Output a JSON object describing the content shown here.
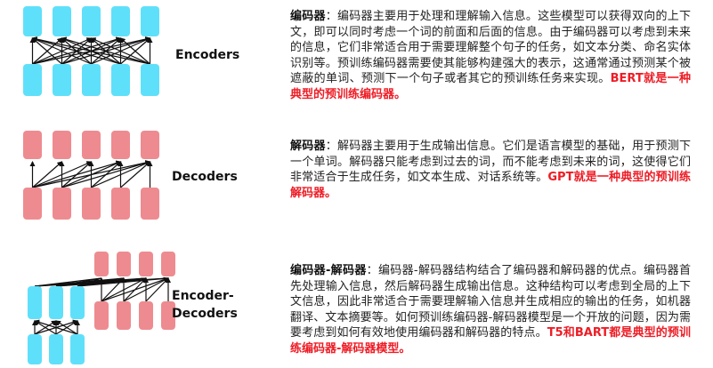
{
  "colors": {
    "encoder": "#5fe0fa",
    "decoder": "#ee8b90",
    "arrow": "#111111",
    "highlight": "#ee1c25"
  },
  "rows": [
    {
      "id": "encoders",
      "label": "Encoders",
      "term": "编码器",
      "colon": "：",
      "body": "编码器主要用于处理和理解输入信息。这些模型可以获得双向的上下文，即可以同时考虑一个词的前面和后面的信息。由于编码器可以考虑到未来的信息，它们非常适合用于需要理解整个句子的任务，如文本分类、命名实体识别等。预训练编码器需要使其能够构建强大的表示，这通常通过预测某个被遮蔽的单词、预测下一个句子或者其它的预训练任务来实现。",
      "highlight": "BERT就是一种典型的预训练编码器。"
    },
    {
      "id": "decoders",
      "label": "Decoders",
      "term": "解码器",
      "colon": "：",
      "body": "解码器主要用于生成输出信息。它们是语言模型的基础，用于预测下一个单词。解码器只能考虑到过去的词，而不能考虑到未来的词，这使得它们非常适合于生成任务，如文本生成、对话系统等。",
      "highlight": "GPT就是一种典型的预训练解码器。"
    },
    {
      "id": "encoder-decoders",
      "label_line1": "Encoder-",
      "label_line2": "Decoders",
      "term": "编码器-解码器",
      "colon": "：",
      "body": "编码器-解码器结构结合了编码器和解码器的优点。编码器首先处理输入信息，然后解码器生成输出信息。这种结构可以考虑到全局的上下文信息，因此非常适合于需要理解输入信息并生成相应的输出的任务，如机器翻译、文本摘要等。如何预训练编码器-解码器模型是一个开放的问题，因为需要考虑到如何有效地使用编码器和解码器的特点。",
      "highlight": "T5和BART都是典型的预训练编码器-解码器模型。"
    }
  ]
}
